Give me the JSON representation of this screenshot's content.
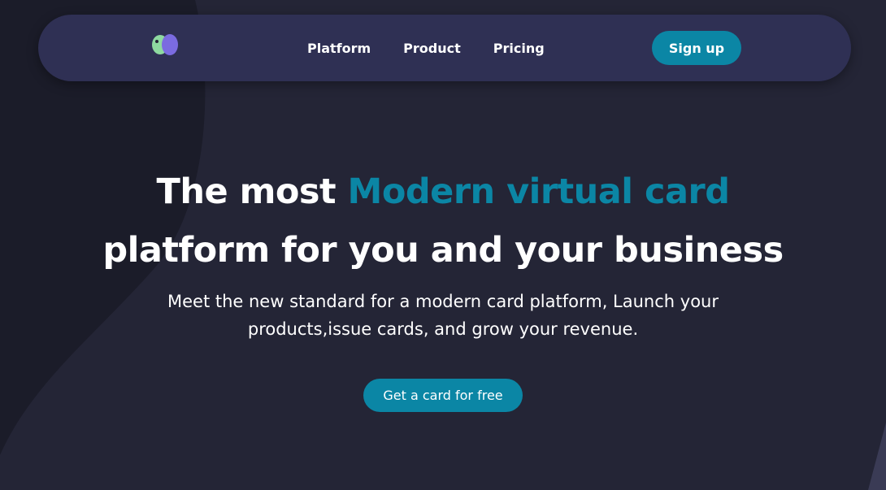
{
  "nav": {
    "links": [
      {
        "label": "Platform"
      },
      {
        "label": "Product"
      },
      {
        "label": "Pricing"
      }
    ],
    "signup_label": "Sign up"
  },
  "hero": {
    "headline_prefix": "The most ",
    "headline_accent": "Modern virtual card",
    "headline_line2": "platform for you and your business",
    "subtext_line1": "Meet the new standard for a modern card platform, Launch your",
    "subtext_line2": "products,issue cards, and grow your revenue.",
    "cta_label": "Get a card for free"
  },
  "colors": {
    "background": "#242536",
    "navbar": "#2f3054",
    "accent": "#0b86a5",
    "logo_green": "#8ed9a0",
    "logo_purple": "#7b6be0"
  },
  "icons": {
    "logo": "two-blob-logo-icon"
  }
}
